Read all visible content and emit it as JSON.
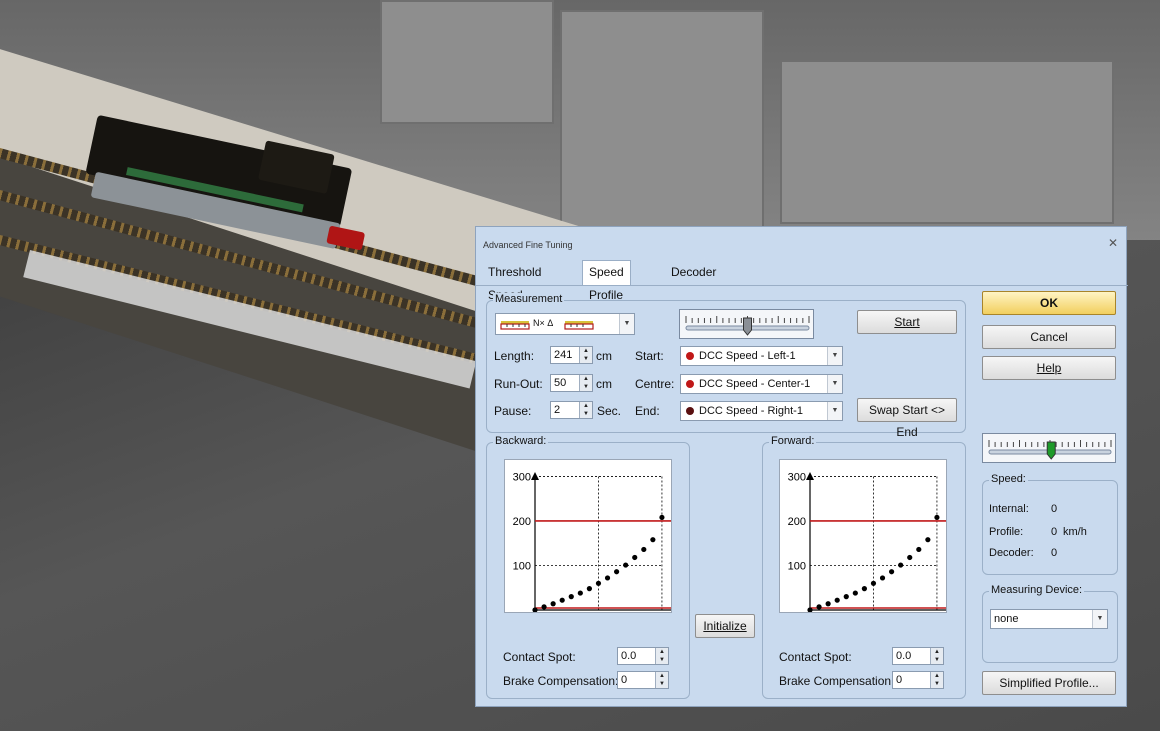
{
  "dialog": {
    "title": "Advanced Fine Tuning",
    "tabs": [
      "Threshold Speed",
      "Speed Profile",
      "Decoder"
    ],
    "active_tab": 1
  },
  "measurement": {
    "label": "Measurement",
    "device_combo_text": "N× Δ",
    "start_button": "Start",
    "swap_button": "Swap Start <> End",
    "length": {
      "label": "Length:",
      "value": "241",
      "unit": "cm"
    },
    "runout": {
      "label": "Run-Out:",
      "value": "50",
      "unit": "cm"
    },
    "pause": {
      "label": "Pause:",
      "value": "2",
      "unit": "Sec."
    },
    "start": {
      "label": "Start:",
      "value": "DCC Speed - Left-1"
    },
    "centre": {
      "label": "Centre:",
      "value": "DCC Speed - Center-1"
    },
    "end": {
      "label": "End:",
      "value": "DCC Speed - Right-1"
    },
    "slider_level": 0.5
  },
  "backward": {
    "label": "Backward:",
    "contact_spot": {
      "label": "Contact Spot:",
      "value": "0.0"
    },
    "brake_compensation": {
      "label": "Brake Compensation:",
      "value": "0"
    }
  },
  "forward": {
    "label": "Forward:",
    "contact_spot": {
      "label": "Contact Spot:",
      "value": "0.0"
    },
    "brake_compensation": {
      "label": "Brake Compensation:",
      "value": "0"
    }
  },
  "initialize_button": "Initialize",
  "right_panel": {
    "ok": "OK",
    "cancel": "Cancel",
    "help": "Help",
    "slider_level": 0.51,
    "speed": {
      "label": "Speed:",
      "internal_label": "Internal:",
      "internal_value": "0",
      "profile_label": "Profile:",
      "profile_value": "0",
      "profile_unit": "km/h",
      "decoder_label": "Decoder:",
      "decoder_value": "0"
    },
    "measuring_device": {
      "label": "Measuring Device:",
      "value": "none"
    },
    "simplified_profile": "Simplified Profile..."
  },
  "colors": {
    "dialog_bg": "#c9daee",
    "ok_button": "#f2cf5e",
    "limit_line": "#c0181a",
    "thumb_green": "#1e9a2a"
  },
  "chart_data": [
    {
      "type": "scatter",
      "name": "backward",
      "x": [
        0,
        2,
        4,
        6,
        8,
        10,
        12,
        14,
        16,
        18,
        20,
        22,
        24,
        26,
        28
      ],
      "y": [
        0,
        7,
        14,
        22,
        30,
        38,
        48,
        60,
        72,
        86,
        101,
        118,
        136,
        158,
        208
      ],
      "x_ticks": [
        "0",
        "14",
        "28"
      ],
      "y_ticks": [
        "100",
        "200",
        "300"
      ],
      "xlim": [
        0,
        30
      ],
      "ylim": [
        0,
        310
      ],
      "hlines": [
        0,
        200
      ],
      "grid_x": [
        14,
        28
      ],
      "grid_y": [
        100,
        200,
        300
      ]
    },
    {
      "type": "scatter",
      "name": "forward",
      "x": [
        0,
        2,
        4,
        6,
        8,
        10,
        12,
        14,
        16,
        18,
        20,
        22,
        24,
        26,
        28
      ],
      "y": [
        0,
        7,
        14,
        22,
        30,
        38,
        48,
        60,
        72,
        86,
        101,
        118,
        136,
        158,
        208
      ],
      "x_ticks": [
        "0",
        "14",
        "28"
      ],
      "y_ticks": [
        "100",
        "200",
        "300"
      ],
      "xlim": [
        0,
        30
      ],
      "ylim": [
        0,
        310
      ],
      "hlines": [
        0,
        200
      ],
      "grid_x": [
        14,
        28
      ],
      "grid_y": [
        100,
        200,
        300
      ]
    }
  ]
}
